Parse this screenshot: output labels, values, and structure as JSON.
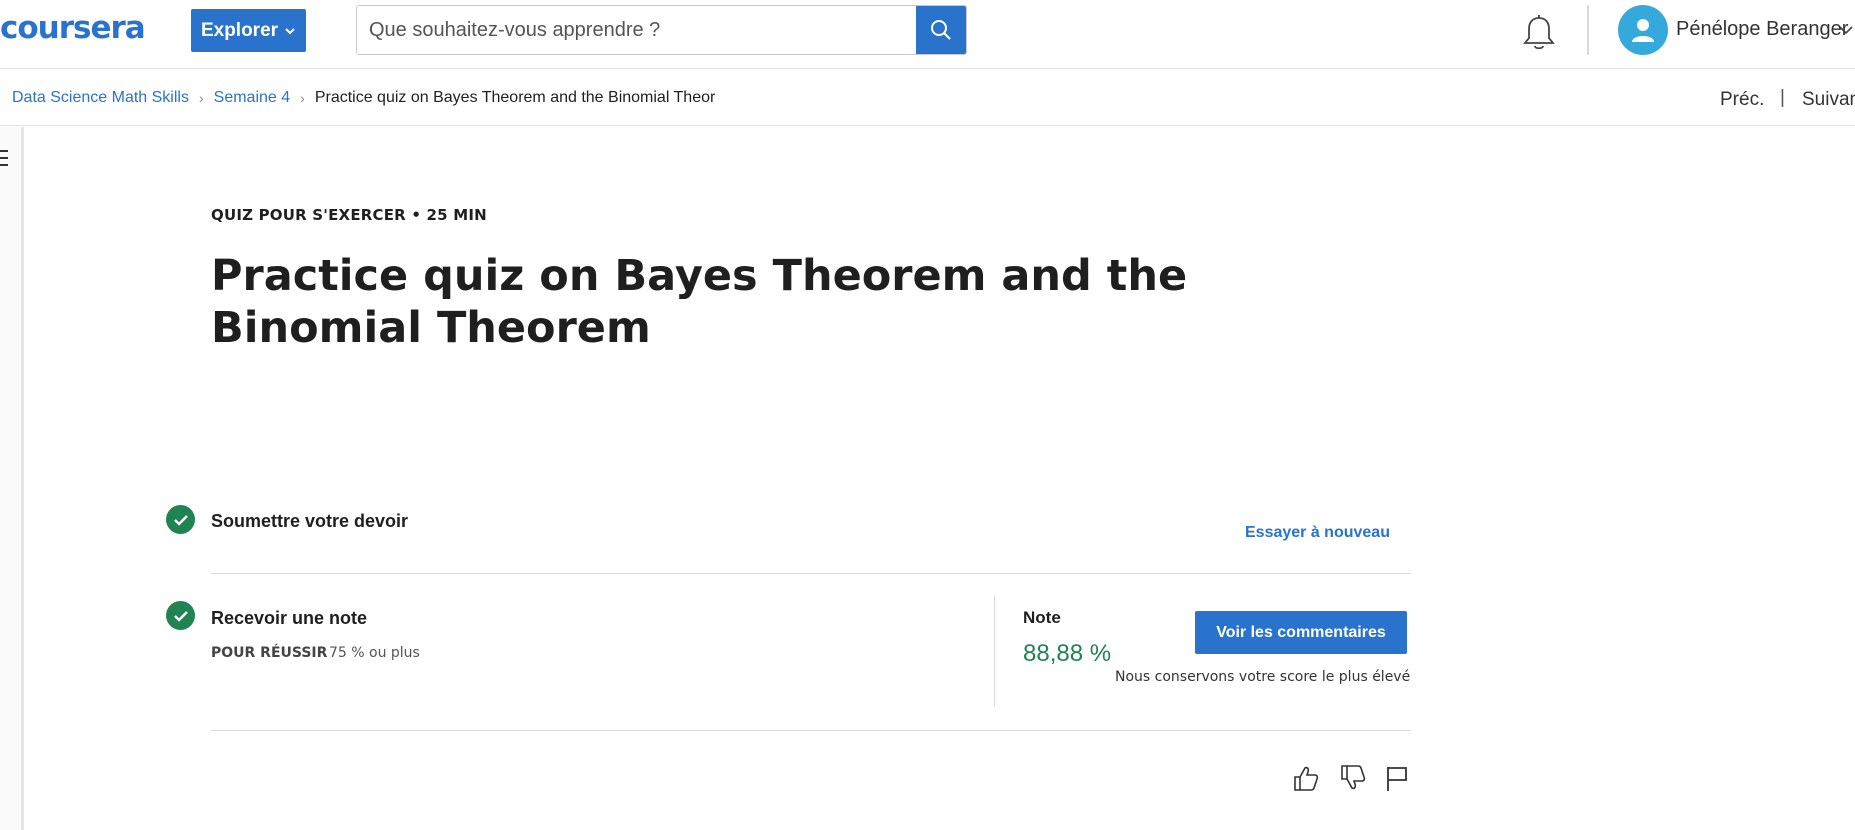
{
  "header": {
    "logo_text": "coursera",
    "explore_label": "Explorer",
    "search_placeholder": "Que souhaitez-vous apprendre ?",
    "user_name": "Pénélope Beranger"
  },
  "breadcrumb": {
    "items": [
      {
        "label": "Data Science Math Skills"
      },
      {
        "label": "Semaine 4"
      },
      {
        "label": "Practice quiz on Bayes Theorem and the Binomial Theor"
      }
    ],
    "prev_label": "Préc.",
    "separator": "|",
    "next_label": "Suivan"
  },
  "quiz": {
    "eyebrow": "QUIZ POUR S'EXERCER • 25  MIN",
    "title": "Practice quiz on Bayes Theorem and the Binomial Theorem",
    "steps": [
      {
        "title": "Soumettre votre devoir",
        "action_label": "Essayer à nouveau"
      },
      {
        "title": "Recevoir une note",
        "pass_label": "POUR RÉUSSIR",
        "pass_value": "75 % ou plus"
      }
    ],
    "grade": {
      "label": "Note",
      "value": "88,88 %",
      "button_label": "Voir les commentaires",
      "note": "Nous conservons votre score le plus élevé"
    }
  },
  "colors": {
    "accent": "#2a73cc",
    "success": "#1f8354",
    "avatar": "#35a8dc"
  },
  "icons": [
    "search-icon",
    "bell-icon",
    "user-icon",
    "chevron-down-icon",
    "menu-icon",
    "check-icon",
    "thumbs-up-icon",
    "thumbs-down-icon",
    "flag-icon"
  ]
}
